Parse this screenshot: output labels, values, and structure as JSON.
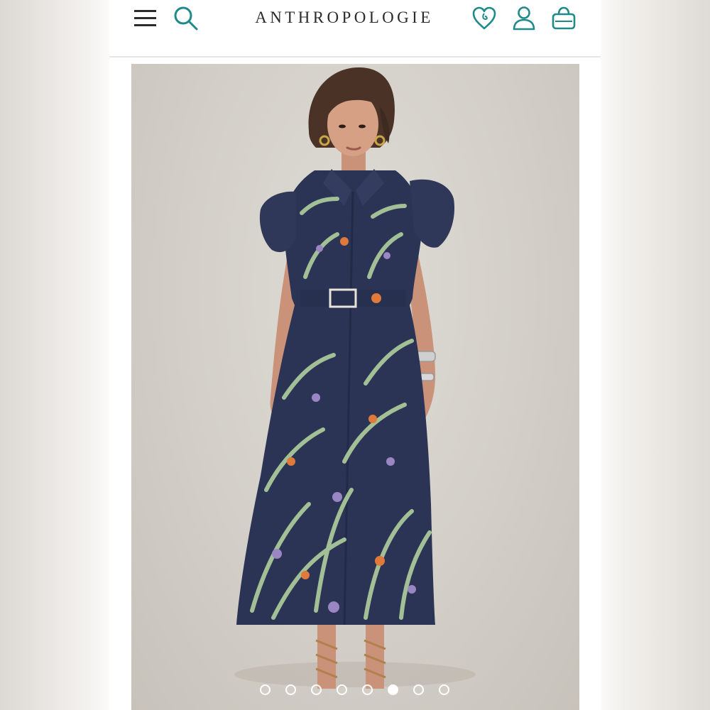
{
  "header": {
    "brand": "ANTHROPOLOGIE",
    "icons": [
      "menu-icon",
      "search-icon",
      "heart-icon",
      "account-icon",
      "shopping-bag-icon"
    ]
  },
  "gallery": {
    "image": "model-wearing-floral-print-shirt-dress",
    "slide_count": 8,
    "active_slide": 6
  },
  "colors": {
    "accent": "#1f8a8a",
    "text": "#2b2b2b",
    "dress_navy": "#2c3456"
  }
}
